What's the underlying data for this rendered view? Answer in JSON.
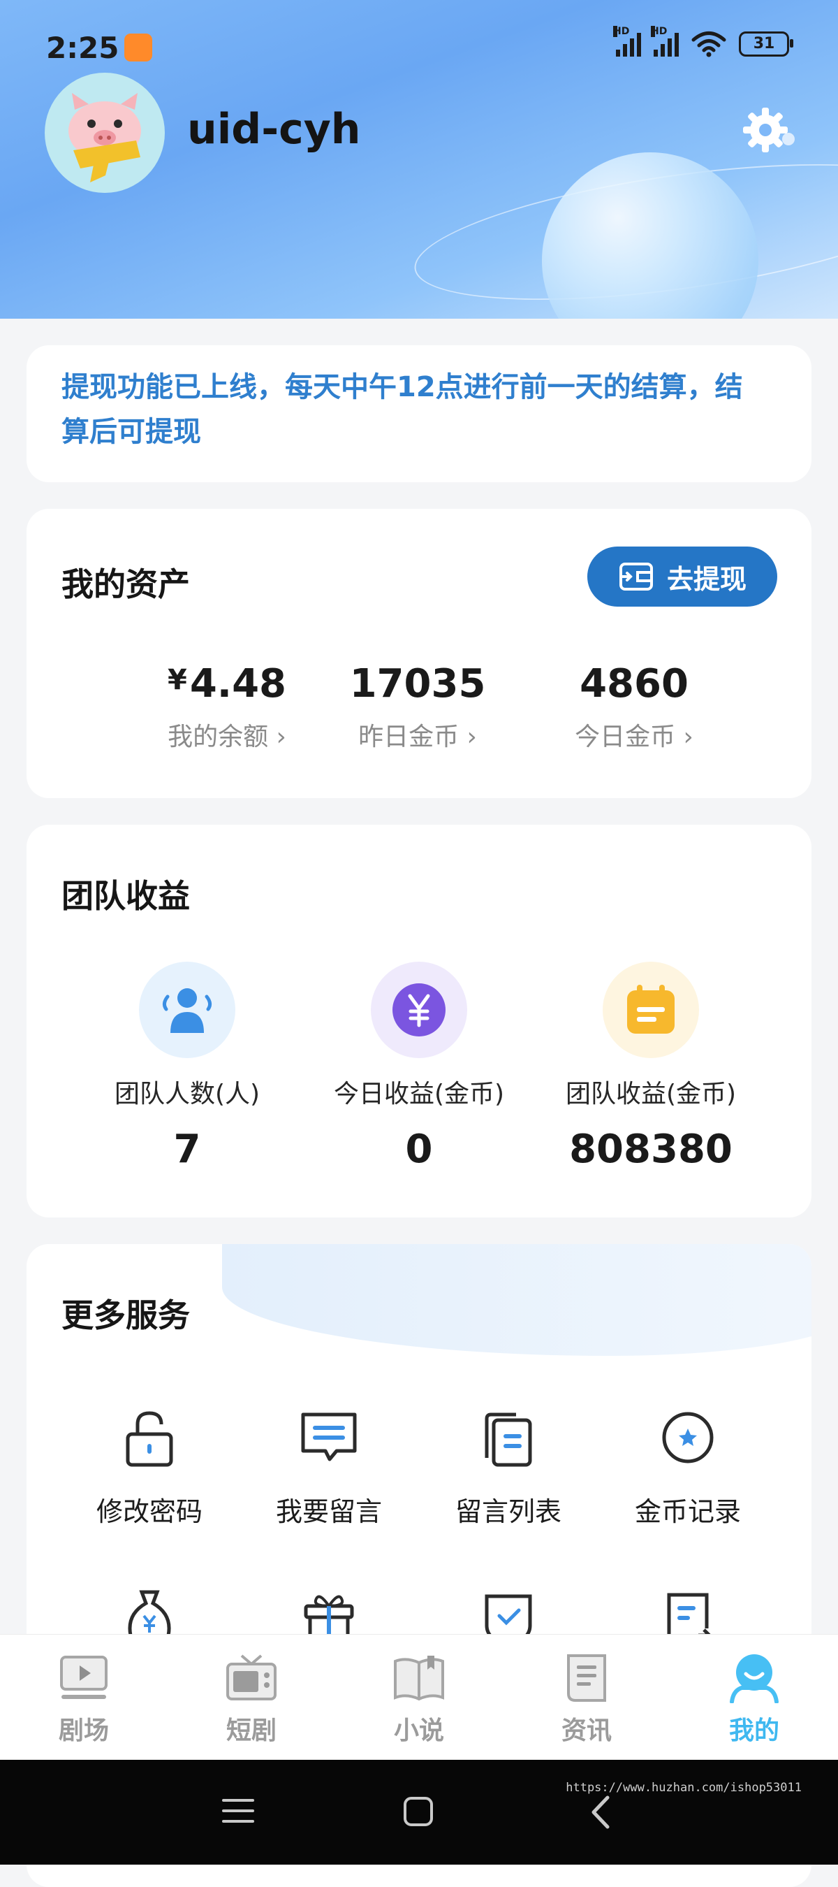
{
  "status_bar": {
    "time": "2:25",
    "signal1_label": "HD",
    "signal2_label": "HD",
    "battery": "31"
  },
  "profile": {
    "username": "uid-cyh"
  },
  "notice": {
    "text": "提现功能已上线，每天中午12点进行前一天的结算，结算后可提现"
  },
  "assets": {
    "title": "我的资产",
    "withdraw_label": "去提现",
    "stats": [
      {
        "currency": "¥",
        "value": "4.48",
        "label": "我的余额"
      },
      {
        "value": "17035",
        "label": "昨日金币"
      },
      {
        "value": "4860",
        "label": "今日金币"
      }
    ]
  },
  "team": {
    "title": "团队收益",
    "stats": [
      {
        "label": "团队人数(人)",
        "value": "7",
        "icon": "user-group-icon"
      },
      {
        "label": "今日收益(金币)",
        "value": "0",
        "icon": "yen-coin-icon"
      },
      {
        "label": "团队收益(金币)",
        "value": "808380",
        "icon": "calendar-note-icon"
      }
    ]
  },
  "services": {
    "title": "更多服务",
    "items": [
      {
        "label": "修改密码",
        "icon": "lock-icon"
      },
      {
        "label": "我要留言",
        "icon": "message-icon"
      },
      {
        "label": "留言列表",
        "icon": "documents-icon"
      },
      {
        "label": "金币记录",
        "icon": "star-coin-icon"
      }
    ]
  },
  "nav": {
    "items": [
      {
        "label": "剧场",
        "icon": "play-screen-icon"
      },
      {
        "label": "短剧",
        "icon": "tv-icon"
      },
      {
        "label": "小说",
        "icon": "book-icon"
      },
      {
        "label": "资讯",
        "icon": "news-icon"
      },
      {
        "label": "我的",
        "icon": "profile-icon",
        "active": true
      }
    ]
  },
  "watermark": "https://www.huzhan.com/ishop53011",
  "colors": {
    "accent": "#2576c6",
    "notice_text": "#2f7fce",
    "nav_active": "#3fb8f0"
  }
}
